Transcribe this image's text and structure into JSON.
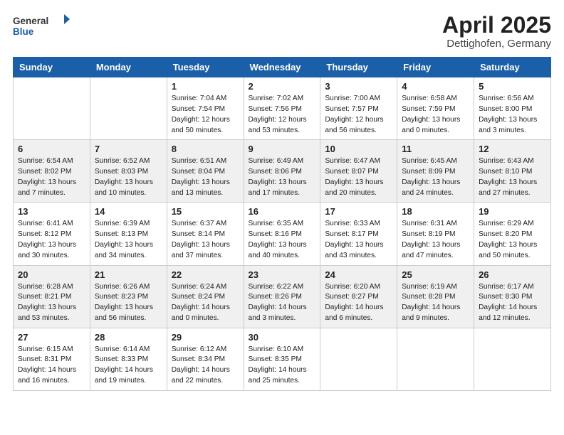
{
  "logo": {
    "general": "General",
    "blue": "Blue"
  },
  "header": {
    "title": "April 2025",
    "subtitle": "Dettighofen, Germany"
  },
  "weekdays": [
    "Sunday",
    "Monday",
    "Tuesday",
    "Wednesday",
    "Thursday",
    "Friday",
    "Saturday"
  ],
  "weeks": [
    [
      {
        "day": "",
        "text": ""
      },
      {
        "day": "",
        "text": ""
      },
      {
        "day": "1",
        "text": "Sunrise: 7:04 AM\nSunset: 7:54 PM\nDaylight: 12 hours and 50 minutes."
      },
      {
        "day": "2",
        "text": "Sunrise: 7:02 AM\nSunset: 7:56 PM\nDaylight: 12 hours and 53 minutes."
      },
      {
        "day": "3",
        "text": "Sunrise: 7:00 AM\nSunset: 7:57 PM\nDaylight: 12 hours and 56 minutes."
      },
      {
        "day": "4",
        "text": "Sunrise: 6:58 AM\nSunset: 7:59 PM\nDaylight: 13 hours and 0 minutes."
      },
      {
        "day": "5",
        "text": "Sunrise: 6:56 AM\nSunset: 8:00 PM\nDaylight: 13 hours and 3 minutes."
      }
    ],
    [
      {
        "day": "6",
        "text": "Sunrise: 6:54 AM\nSunset: 8:02 PM\nDaylight: 13 hours and 7 minutes."
      },
      {
        "day": "7",
        "text": "Sunrise: 6:52 AM\nSunset: 8:03 PM\nDaylight: 13 hours and 10 minutes."
      },
      {
        "day": "8",
        "text": "Sunrise: 6:51 AM\nSunset: 8:04 PM\nDaylight: 13 hours and 13 minutes."
      },
      {
        "day": "9",
        "text": "Sunrise: 6:49 AM\nSunset: 8:06 PM\nDaylight: 13 hours and 17 minutes."
      },
      {
        "day": "10",
        "text": "Sunrise: 6:47 AM\nSunset: 8:07 PM\nDaylight: 13 hours and 20 minutes."
      },
      {
        "day": "11",
        "text": "Sunrise: 6:45 AM\nSunset: 8:09 PM\nDaylight: 13 hours and 24 minutes."
      },
      {
        "day": "12",
        "text": "Sunrise: 6:43 AM\nSunset: 8:10 PM\nDaylight: 13 hours and 27 minutes."
      }
    ],
    [
      {
        "day": "13",
        "text": "Sunrise: 6:41 AM\nSunset: 8:12 PM\nDaylight: 13 hours and 30 minutes."
      },
      {
        "day": "14",
        "text": "Sunrise: 6:39 AM\nSunset: 8:13 PM\nDaylight: 13 hours and 34 minutes."
      },
      {
        "day": "15",
        "text": "Sunrise: 6:37 AM\nSunset: 8:14 PM\nDaylight: 13 hours and 37 minutes."
      },
      {
        "day": "16",
        "text": "Sunrise: 6:35 AM\nSunset: 8:16 PM\nDaylight: 13 hours and 40 minutes."
      },
      {
        "day": "17",
        "text": "Sunrise: 6:33 AM\nSunset: 8:17 PM\nDaylight: 13 hours and 43 minutes."
      },
      {
        "day": "18",
        "text": "Sunrise: 6:31 AM\nSunset: 8:19 PM\nDaylight: 13 hours and 47 minutes."
      },
      {
        "day": "19",
        "text": "Sunrise: 6:29 AM\nSunset: 8:20 PM\nDaylight: 13 hours and 50 minutes."
      }
    ],
    [
      {
        "day": "20",
        "text": "Sunrise: 6:28 AM\nSunset: 8:21 PM\nDaylight: 13 hours and 53 minutes."
      },
      {
        "day": "21",
        "text": "Sunrise: 6:26 AM\nSunset: 8:23 PM\nDaylight: 13 hours and 56 minutes."
      },
      {
        "day": "22",
        "text": "Sunrise: 6:24 AM\nSunset: 8:24 PM\nDaylight: 14 hours and 0 minutes."
      },
      {
        "day": "23",
        "text": "Sunrise: 6:22 AM\nSunset: 8:26 PM\nDaylight: 14 hours and 3 minutes."
      },
      {
        "day": "24",
        "text": "Sunrise: 6:20 AM\nSunset: 8:27 PM\nDaylight: 14 hours and 6 minutes."
      },
      {
        "day": "25",
        "text": "Sunrise: 6:19 AM\nSunset: 8:28 PM\nDaylight: 14 hours and 9 minutes."
      },
      {
        "day": "26",
        "text": "Sunrise: 6:17 AM\nSunset: 8:30 PM\nDaylight: 14 hours and 12 minutes."
      }
    ],
    [
      {
        "day": "27",
        "text": "Sunrise: 6:15 AM\nSunset: 8:31 PM\nDaylight: 14 hours and 16 minutes."
      },
      {
        "day": "28",
        "text": "Sunrise: 6:14 AM\nSunset: 8:33 PM\nDaylight: 14 hours and 19 minutes."
      },
      {
        "day": "29",
        "text": "Sunrise: 6:12 AM\nSunset: 8:34 PM\nDaylight: 14 hours and 22 minutes."
      },
      {
        "day": "30",
        "text": "Sunrise: 6:10 AM\nSunset: 8:35 PM\nDaylight: 14 hours and 25 minutes."
      },
      {
        "day": "",
        "text": ""
      },
      {
        "day": "",
        "text": ""
      },
      {
        "day": "",
        "text": ""
      }
    ]
  ]
}
